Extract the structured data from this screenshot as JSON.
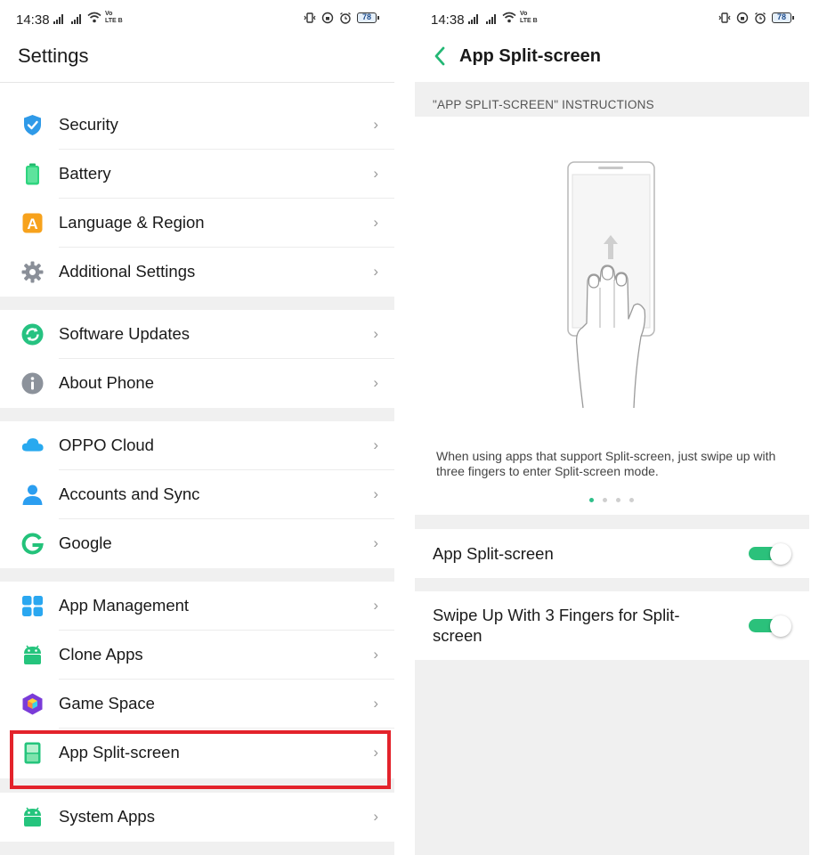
{
  "status_bar": {
    "time": "14:38",
    "volte_line1": "Vo",
    "volte_line2": "LTE B",
    "battery": "78"
  },
  "left": {
    "title": "Settings",
    "groups": [
      {
        "items": [
          {
            "label": "Security",
            "icon": "shield-icon"
          },
          {
            "label": "Battery",
            "icon": "battery-icon"
          },
          {
            "label": "Language & Region",
            "icon": "language-icon"
          },
          {
            "label": "Additional Settings",
            "icon": "gear-icon"
          }
        ]
      },
      {
        "items": [
          {
            "label": "Software Updates",
            "icon": "update-icon"
          },
          {
            "label": "About Phone",
            "icon": "info-icon"
          }
        ]
      },
      {
        "items": [
          {
            "label": "OPPO Cloud",
            "icon": "cloud-icon"
          },
          {
            "label": "Accounts and Sync",
            "icon": "person-icon"
          },
          {
            "label": "Google",
            "icon": "google-icon"
          }
        ]
      },
      {
        "items": [
          {
            "label": "App Management",
            "icon": "grid-icon"
          },
          {
            "label": "Clone Apps",
            "icon": "android-icon"
          },
          {
            "label": "Game Space",
            "icon": "game-icon"
          },
          {
            "label": "App Split-screen",
            "icon": "split-screen-icon"
          }
        ]
      },
      {
        "items": [
          {
            "label": "System Apps",
            "icon": "android-icon"
          }
        ]
      }
    ],
    "chevron": "›",
    "highlighted_item": "App Split-screen"
  },
  "right": {
    "title": "App Split-screen",
    "section_label": "\"APP SPLIT-SCREEN\" INSTRUCTIONS",
    "description": "When using apps that support Split-screen, just swipe up with three fingers to enter Split-screen mode.",
    "page_dots": {
      "count": 4,
      "active": 0
    },
    "toggles": [
      {
        "label": "App Split-screen",
        "on": true
      },
      {
        "label": "Swipe Up With 3 Fingers for Split-screen",
        "on": true
      }
    ]
  },
  "colors": {
    "accent_green": "#2bc17b",
    "highlight_red": "#e3232b",
    "divider_gray": "#f0f0f0"
  }
}
